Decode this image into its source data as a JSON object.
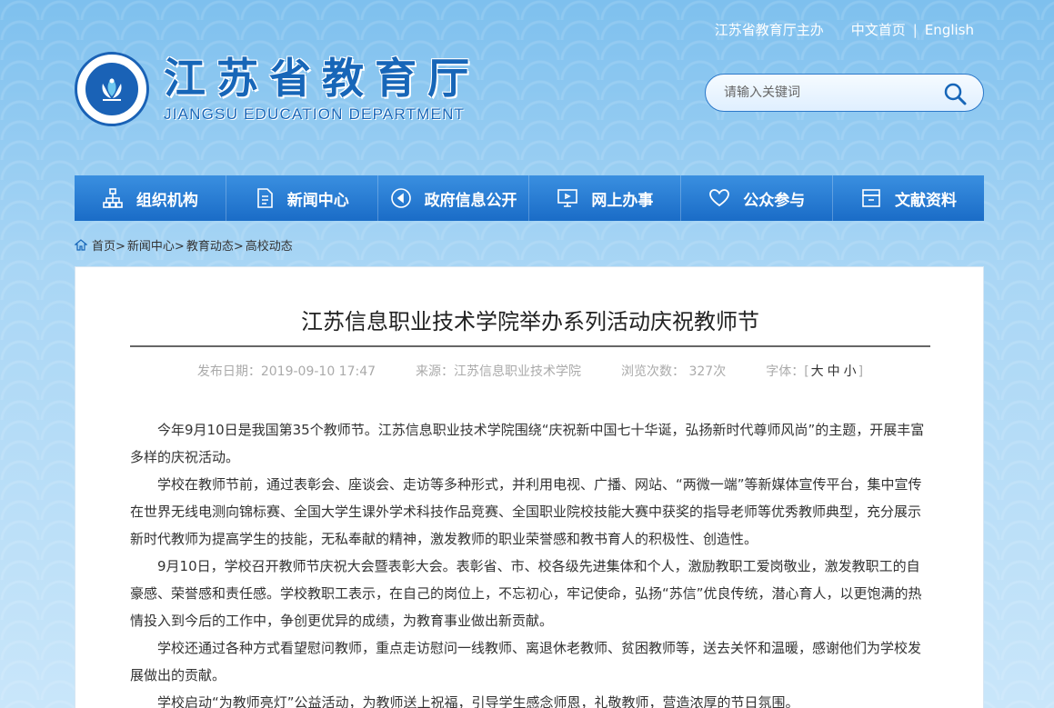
{
  "header": {
    "sponsor": "江苏省教育厅主办",
    "home_cn": "中文首页",
    "separator": "|",
    "english": "English",
    "logo_cn": "江苏省教育厅",
    "logo_en": "JIANGSU EDUCATION DEPARTMENT"
  },
  "search": {
    "placeholder": "请输入关键词"
  },
  "nav": {
    "items": [
      {
        "label": "组织机构",
        "icon": "org-chart-icon"
      },
      {
        "label": "新闻中心",
        "icon": "document-icon"
      },
      {
        "label": "政府信息公开",
        "icon": "play-circle-icon"
      },
      {
        "label": "网上办事",
        "icon": "monitor-icon"
      },
      {
        "label": "公众参与",
        "icon": "heart-icon"
      },
      {
        "label": "文献资料",
        "icon": "archive-icon"
      }
    ]
  },
  "breadcrumb": [
    "首页>",
    "新闻中心>",
    "教育动态>",
    "高校动态"
  ],
  "article": {
    "title": "江苏信息职业技术学院举办系列活动庆祝教师节",
    "date_label": "发布日期：2019-09-10 17:47",
    "source_label": "来源：江苏信息职业技术学院",
    "views_label": "浏览次数： 327次",
    "font_label": "字体：[",
    "font_large": "大",
    "font_medium": "中",
    "font_small": "小",
    "font_close": "]",
    "paragraphs": [
      "今年9月10日是我国第35个教师节。江苏信息职业技术学院围绕“庆祝新中国七十华诞，弘扬新时代尊师风尚”的主题，开展丰富多样的庆祝活动。",
      "学校在教师节前，通过表彰会、座谈会、走访等多种形式，并利用电视、广播、网站、“两微一端”等新媒体宣传平台，集中宣传在世界无线电测向锦标赛、全国大学生课外学术科技作品竞赛、全国职业院校技能大赛中获奖的指导老师等优秀教师典型，充分展示新时代教师为提高学生的技能，无私奉献的精神，激发教师的职业荣誉感和教书育人的积极性、创造性。",
      "9月10日，学校召开教师节庆祝大会暨表彰大会。表彰省、市、校各级先进集体和个人，激励教职工爱岗敬业，激发教职工的自豪感、荣誉感和责任感。学校教职工表示，在自己的岗位上，不忘初心，牢记使命，弘扬“苏信”优良传统，潜心育人，以更饱满的热情投入到今后的工作中，争创更优异的成绩，为教育事业做出新贡献。",
      "学校还通过各种方式看望慰问教师，重点走访慰问一线教师、离退休老教师、贫困教师等，送去关怀和温暖，感谢他们为学校发展做出的贡献。",
      "学校启动“为教师亮灯”公益活动，为教师送上祝福，引导学生感念师恩，礼敬教师，营造浓厚的节日氛围。"
    ]
  },
  "colors": {
    "brand": "#1766b8",
    "nav_top": "#3a8fe0",
    "nav_bottom": "#1a6cc7"
  }
}
